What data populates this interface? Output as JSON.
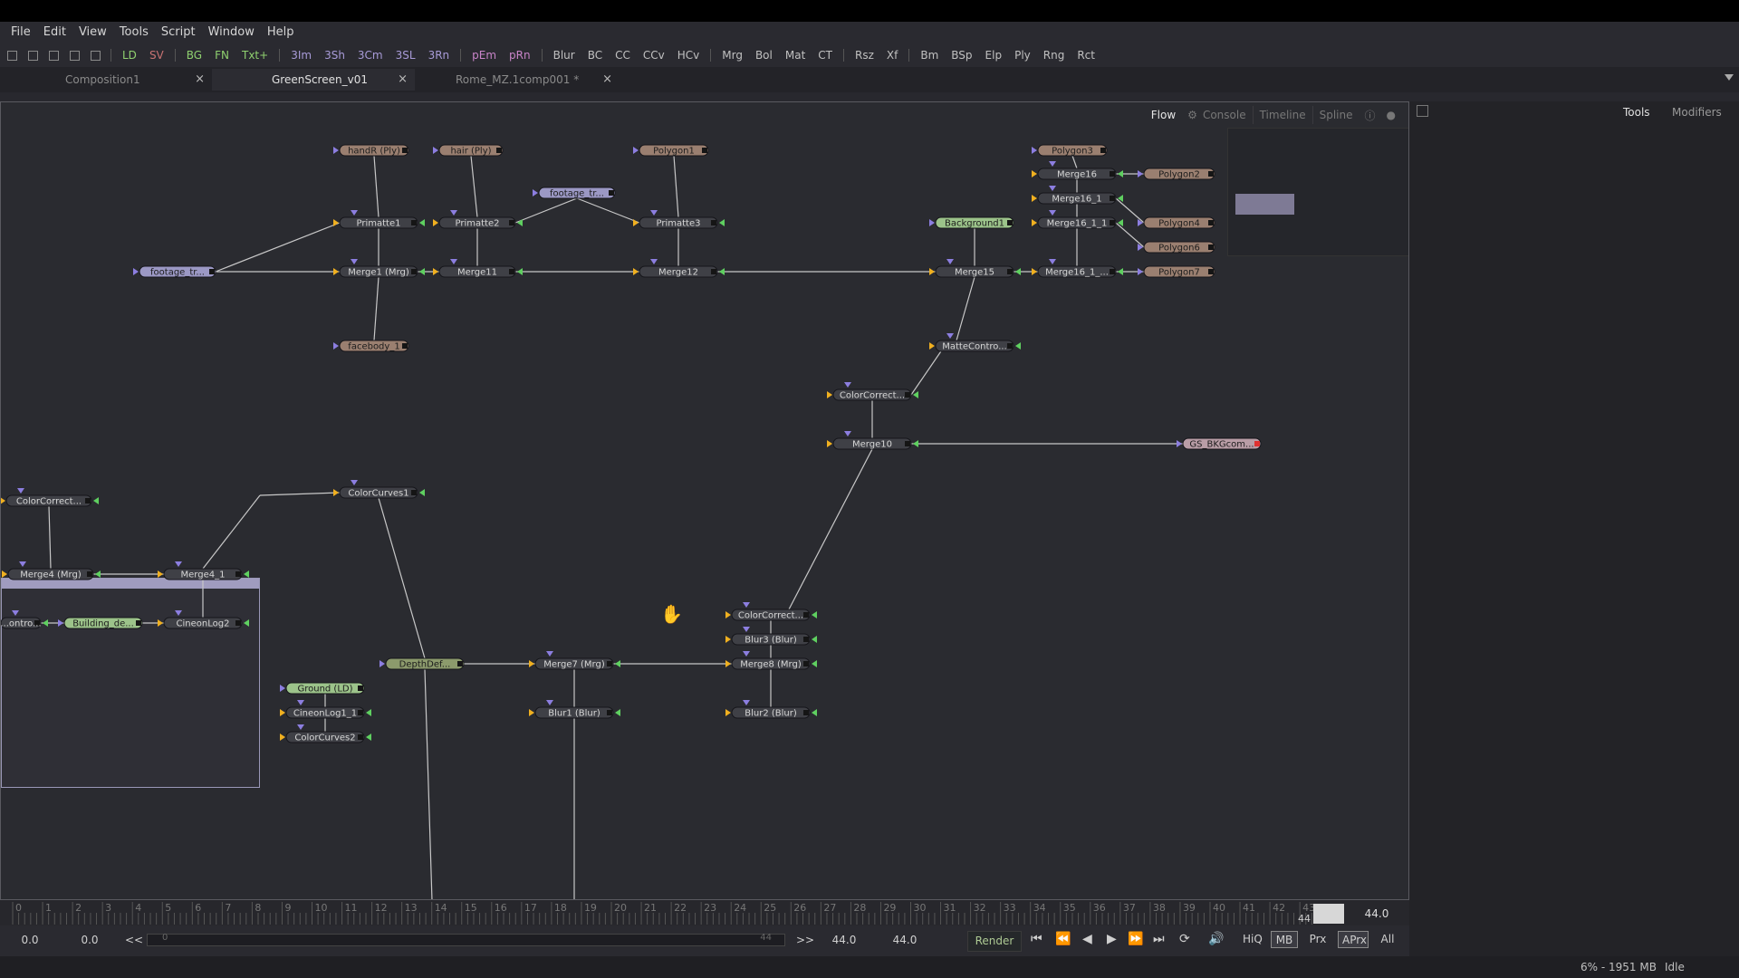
{
  "menu": [
    "File",
    "Edit",
    "View",
    "Tools",
    "Script",
    "Window",
    "Help"
  ],
  "toolbar": [
    {
      "label": "LD",
      "color": "#8fd06f"
    },
    {
      "label": "SV",
      "color": "#c97373"
    },
    {
      "label": "BG",
      "color": "#8fd06f"
    },
    {
      "label": "FN",
      "color": "#8fd06f"
    },
    {
      "label": "Txt+",
      "color": "#8fd06f"
    },
    {
      "label": "3Im",
      "color": "#a89bd8"
    },
    {
      "label": "3Sh",
      "color": "#a89bd8"
    },
    {
      "label": "3Cm",
      "color": "#a89bd8"
    },
    {
      "label": "3SL",
      "color": "#a89bd8"
    },
    {
      "label": "3Rn",
      "color": "#a89bd8"
    },
    {
      "label": "pEm",
      "color": "#c884c8"
    },
    {
      "label": "pRn",
      "color": "#c884c8"
    },
    {
      "label": "Blur",
      "color": "#c0c0c0"
    },
    {
      "label": "BC",
      "color": "#c0c0c0"
    },
    {
      "label": "CC",
      "color": "#c0c0c0"
    },
    {
      "label": "CCv",
      "color": "#c0c0c0"
    },
    {
      "label": "HCv",
      "color": "#c0c0c0"
    },
    {
      "label": "Mrg",
      "color": "#c0c0c0"
    },
    {
      "label": "Bol",
      "color": "#c0c0c0"
    },
    {
      "label": "Mat",
      "color": "#c0c0c0"
    },
    {
      "label": "CT",
      "color": "#c0c0c0"
    },
    {
      "label": "Rsz",
      "color": "#c0c0c0"
    },
    {
      "label": "Xf",
      "color": "#c0c0c0"
    },
    {
      "label": "Bm",
      "color": "#c0c0c0"
    },
    {
      "label": "BSp",
      "color": "#c0c0c0"
    },
    {
      "label": "Elp",
      "color": "#c0c0c0"
    },
    {
      "label": "Ply",
      "color": "#c0c0c0"
    },
    {
      "label": "Rng",
      "color": "#c0c0c0"
    },
    {
      "label": "Rct",
      "color": "#c0c0c0"
    }
  ],
  "doc_tabs": [
    {
      "label": "Composition1",
      "active": false
    },
    {
      "label": "GreenScreen_v01",
      "active": true
    },
    {
      "label": "Rome_MZ.1comp001 *",
      "active": false
    }
  ],
  "tab_close": "×",
  "flow_tabs": {
    "flow": "Flow",
    "console": "Console",
    "timeline": "Timeline",
    "spline": "Spline"
  },
  "nodes": [
    {
      "id": "handR",
      "label": "handR (Ply)",
      "kind": "ply"
    },
    {
      "id": "hair",
      "label": "hair (Ply)",
      "kind": "ply"
    },
    {
      "id": "Polygon1",
      "label": "Polygon1",
      "kind": "ply"
    },
    {
      "id": "Polygon3",
      "label": "Polygon3",
      "kind": "ply"
    },
    {
      "id": "Merge16",
      "label": "Merge16",
      "kind": "tool"
    },
    {
      "id": "Polygon2",
      "label": "Polygon2",
      "kind": "ply"
    },
    {
      "id": "Merge16_1",
      "label": "Merge16_1",
      "kind": "tool"
    },
    {
      "id": "footage_top",
      "label": "footage_tr...",
      "kind": "footage"
    },
    {
      "id": "Primatte1",
      "label": "Primatte1",
      "kind": "tool"
    },
    {
      "id": "Primatte2",
      "label": "Primatte2",
      "kind": "tool"
    },
    {
      "id": "Primatte3",
      "label": "Primatte3",
      "kind": "tool"
    },
    {
      "id": "Background1",
      "label": "Background1",
      "kind": "bg"
    },
    {
      "id": "Merge16_1_1",
      "label": "Merge16_1_1",
      "kind": "tool"
    },
    {
      "id": "Polygon4",
      "label": "Polygon4",
      "kind": "ply"
    },
    {
      "id": "Polygon6",
      "label": "Polygon6",
      "kind": "ply"
    },
    {
      "id": "footage_left",
      "label": "footage_tr...",
      "kind": "footage"
    },
    {
      "id": "Merge1",
      "label": "Merge1 (Mrg)",
      "kind": "tool"
    },
    {
      "id": "Merge11",
      "label": "Merge11",
      "kind": "tool"
    },
    {
      "id": "Merge12",
      "label": "Merge12",
      "kind": "tool"
    },
    {
      "id": "Merge15",
      "label": "Merge15",
      "kind": "tool"
    },
    {
      "id": "Merge16_1_x",
      "label": "Merge16_1_...",
      "kind": "tool"
    },
    {
      "id": "Polygon7",
      "label": "Polygon7",
      "kind": "ply"
    },
    {
      "id": "facebody",
      "label": "facebody_1",
      "kind": "ply"
    },
    {
      "id": "MatteControl",
      "label": "MatteContro...",
      "kind": "tool"
    },
    {
      "id": "ColorCorrectA",
      "label": "ColorCorrect...",
      "kind": "tool"
    },
    {
      "id": "Merge10",
      "label": "Merge10",
      "kind": "tool"
    },
    {
      "id": "GS_BKG",
      "label": "GS_BKGcom...",
      "kind": "saver"
    },
    {
      "id": "ColorCorrectG",
      "label": "ColorCorrect...",
      "kind": "tool"
    },
    {
      "id": "ColorCurves1",
      "label": "ColorCurves1",
      "kind": "tool"
    },
    {
      "id": "Merge4",
      "label": "Merge4 (Mrg)",
      "kind": "tool"
    },
    {
      "id": "Merge4_1",
      "label": "Merge4_1",
      "kind": "tool"
    },
    {
      "id": "MatteCtrlG",
      "label": "...ontro...",
      "kind": "tool"
    },
    {
      "id": "Building",
      "label": "Building_de...",
      "kind": "ld"
    },
    {
      "id": "CineonLog2",
      "label": "CineonLog2",
      "kind": "tool"
    },
    {
      "id": "ColorCorrectB",
      "label": "ColorCorrect...",
      "kind": "tool"
    },
    {
      "id": "Blur3",
      "label": "Blur3 (Blur)",
      "kind": "tool"
    },
    {
      "id": "DepthDef",
      "label": "DepthDef...",
      "kind": "ld2"
    },
    {
      "id": "Merge7",
      "label": "Merge7 (Mrg)",
      "kind": "tool"
    },
    {
      "id": "Merge8",
      "label": "Merge8 (Mrg)",
      "kind": "tool"
    },
    {
      "id": "Ground",
      "label": "Ground (LD)",
      "kind": "ld"
    },
    {
      "id": "CineonLog1_1",
      "label": "CineonLog1_1",
      "kind": "tool"
    },
    {
      "id": "Blur1",
      "label": "Blur1 (Blur)",
      "kind": "tool"
    },
    {
      "id": "Blur2",
      "label": "Blur2 (Blur)",
      "kind": "tool"
    },
    {
      "id": "ColorCurves2",
      "label": "ColorCurves2",
      "kind": "tool"
    }
  ],
  "timeline": {
    "ticks": [
      "0",
      "1",
      "2",
      "3",
      "4",
      "5",
      "6",
      "7",
      "8",
      "9",
      "10",
      "11",
      "12",
      "13",
      "14",
      "15",
      "16",
      "17",
      "18",
      "19",
      "20",
      "21",
      "22",
      "23",
      "24",
      "25",
      "26",
      "27",
      "28",
      "29",
      "30",
      "31",
      "32",
      "33",
      "34",
      "35",
      "36",
      "37",
      "38",
      "39",
      "40",
      "41",
      "42",
      "43"
    ],
    "end_label": "44",
    "current": "44.0"
  },
  "transport": {
    "global_start": "0.0",
    "render_start": "0.0",
    "rew_label": "<<",
    "ff_label": ">>",
    "range_left": "0",
    "range_right": "44",
    "render_end": "44.0",
    "global_end": "44.0",
    "render": "Render",
    "toggles": [
      {
        "label": "HiQ",
        "on": false
      },
      {
        "label": "MB",
        "on": true
      },
      {
        "label": "Prx",
        "on": false
      },
      {
        "label": "APrx",
        "on": true
      },
      {
        "label": "All",
        "on": false
      }
    ]
  },
  "right_panel": {
    "tools": "Tools",
    "modifiers": "Modifiers"
  },
  "status": {
    "memory": "6% - 1951 MB",
    "state": "Idle"
  },
  "colors": {
    "wire": "#c8c8c8",
    "pin_yellow": "#f0b020",
    "pin_green": "#5fd060",
    "pin_blue": "#8c7ee0",
    "pin_red": "#e03030",
    "pin_pink": "#e070d0"
  }
}
